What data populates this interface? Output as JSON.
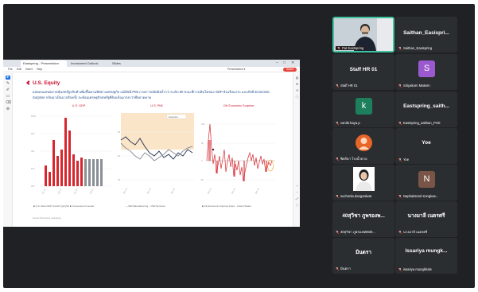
{
  "meeting_bg": "#202124",
  "browser": {
    "tabs": [
      "Eastspring - Presentation",
      "Investment Outlook",
      "Slides"
    ],
    "window_controls": [
      "–",
      "□",
      "✕"
    ],
    "menu": [
      "File",
      "Edit",
      "Insert",
      "Help"
    ],
    "toolbar_right": "Presentation  ▾",
    "share_label": "Share",
    "accent": "#e8453c"
  },
  "slide": {
    "title": "U.S. Equity",
    "body": "ผลตอบแทนตลาดหุ้นสหรัฐปรับตัวเพิ่มขึ้นตามทิศทางเศรษฐกิจ แม้ดัชนี PMI ภาคการผลิตยังต่ำกว่าระดับ 50 ขณะที่การเติบโตของ GDP ยังแข็งแกร่ง และดัชนี Economic Surprise กลับมาเป็นบวกอีกครั้ง สะท้อนเศรษฐกิจสหรัฐที่ยังแข็งแกร่งกว่าที่ตลาดคาด",
    "charts": [
      {
        "title": "U.S. GDP",
        "legend": "■ U.S. Real GDP Growth (QoQ%)  ■ Consensus Forecast"
      },
      {
        "title": "U.S. PMI",
        "legend": "—ISM Manufacturing  —ISM Services"
      },
      {
        "title": "Citi Economic Surprise",
        "legend": "■ Citi Economic Surprise Index - United States"
      }
    ],
    "source": "Source: Bloomberg, Eastspring"
  },
  "participants": [
    {
      "display": "",
      "label": "Pat Eastspring",
      "type": "camera",
      "muted": true
    },
    {
      "display": "Saithan_Easispri...",
      "label": "Saithan_Easispring",
      "type": "name",
      "muted": true
    },
    {
      "display": "Staff HR 01",
      "label": "Staff HR 01",
      "type": "name",
      "muted": true
    },
    {
      "display": "S",
      "label": "Siriyakorn Makern",
      "type": "avatar",
      "color": "#9b59d0",
      "muted": true
    },
    {
      "display": "k",
      "label": "vanitk.haya.p",
      "type": "avatar",
      "color": "#1e7f5c",
      "muted": true
    },
    {
      "display": "Eastspring_saith...",
      "label": "Eastspring_saithan_PVD",
      "type": "name",
      "muted": true
    },
    {
      "display": "",
      "label": "ฟิตรัดา โรงน้ำตาล",
      "type": "photo-orange",
      "muted": true
    },
    {
      "display": "Yoe",
      "label": "Yoe",
      "type": "name",
      "muted": true
    },
    {
      "display": "",
      "label": "suchonla.dangsalwat",
      "type": "photo-person",
      "muted": true
    },
    {
      "display": "N",
      "label": "Naphaksmol Kongkae...",
      "type": "avatar",
      "color": "#795548",
      "muted": true
    },
    {
      "display": "40สุวิชา ภูพรองพ...",
      "label": "40สุวิชา ภูพรองพ0830...",
      "type": "name",
      "muted": true
    },
    {
      "display": "นางมาลี เนตรศรี",
      "label": "นางมาลี เนตรศรี",
      "type": "name",
      "muted": true
    },
    {
      "display": "มินตรา",
      "label": "มินตรา",
      "type": "name",
      "muted": true
    },
    {
      "display": "Issariya mungk...",
      "label": "issariya mungkhale",
      "type": "name",
      "muted": true
    }
  ]
}
